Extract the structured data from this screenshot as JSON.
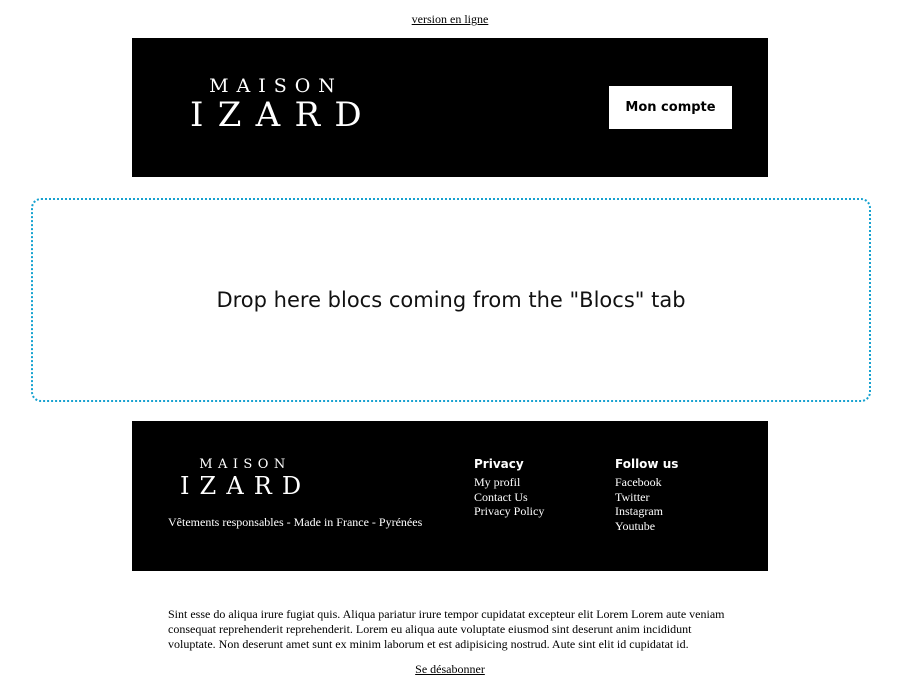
{
  "top_link": "version en ligne",
  "header": {
    "logo_line1": "MAISON",
    "logo_line2": "IZARD",
    "account_button": "Mon compte"
  },
  "dropzone": {
    "message": "Drop here blocs coming from the \"Blocs\" tab",
    "border_color": "#17a2d0"
  },
  "footer": {
    "logo_line1": "MAISON",
    "logo_line2": "IZARD",
    "tagline": "Vêtements responsables - Made in France - Pyrénées",
    "columns": [
      {
        "title": "Privacy",
        "links": [
          "My profil",
          "Contact Us",
          "Privacy Policy"
        ]
      },
      {
        "title": "Follow us",
        "links": [
          "Facebook",
          "Twitter",
          "Instagram",
          "Youtube"
        ]
      }
    ]
  },
  "body_text": "Sint esse do aliqua irure fugiat quis. Aliqua pariatur irure tempor cupidatat excepteur elit Lorem Lorem aute veniam consequat reprehenderit reprehenderit. Lorem eu aliqua aute voluptate eiusmod sint deserunt anim incididunt voluptate. Non deserunt amet sunt ex minim laborum et est adipisicing nostrud. Aute sint elit id cupidatat id.",
  "unsubscribe": "Se désabonner"
}
